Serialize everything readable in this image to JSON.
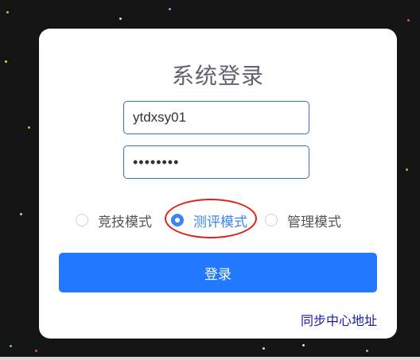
{
  "login": {
    "title": "系统登录",
    "username_value": "ytdxsy01",
    "password_value": "12345678",
    "modes": [
      {
        "label": "竞技模式",
        "checked": false
      },
      {
        "label": "测评模式",
        "checked": true
      },
      {
        "label": "管理模式",
        "checked": false
      }
    ],
    "login_button": "登录",
    "sync_link": "同步中心地址"
  },
  "colors": {
    "accent": "#2278ff",
    "radio_checked": "#3a86f0",
    "highlight_circle": "#e0201c",
    "background": "#141414"
  }
}
